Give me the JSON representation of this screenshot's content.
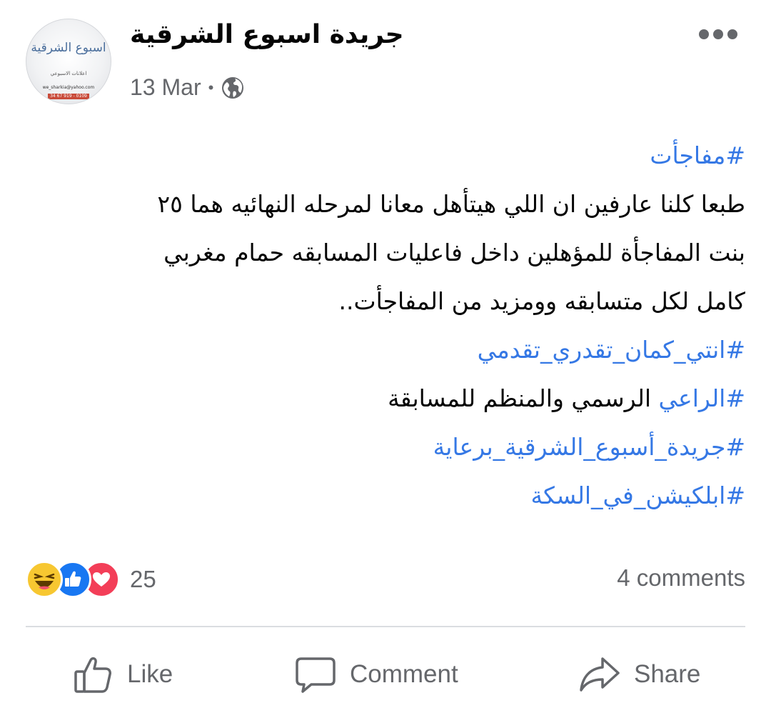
{
  "post": {
    "page_name": "جريدة اسبوع الشرقية",
    "timestamp": "13 Mar",
    "separator": "•",
    "privacy_icon": "globe-icon",
    "avatar": {
      "logo_text": "اسبوع الشرقية",
      "tagline": "اعلانات الاسبوعي",
      "email": "we_sharkia@yahoo.com",
      "phone": "34 67 919 - 0109"
    },
    "body": {
      "hashtag_1": "#مفاجأت",
      "text_line_1": "طبعا كلنا عارفين ان اللي هيتأهل معانا لمرحله النهائيه هما ٢٥",
      "text_line_2": "بنت المفاجأة للمؤهلين داخل فاعليات المسابقه حمام مغربي",
      "text_line_3": "كامل لكل متسابقه وومزيد من المفاجأت..",
      "hashtag_2": "#انتي_كمان_تقدري_تقدمي",
      "hashtag_3": "#الراعي",
      "text_line_4": " الرسمي والمنظم للمسابقة",
      "hashtag_4": "#جريدة_أسبوع_الشرقية_برعاية",
      "hashtag_5": "#ابلكيشن_في_السكة"
    },
    "reactions": {
      "icons": [
        "haha-icon",
        "like-icon",
        "love-icon"
      ],
      "count": "25"
    },
    "comments_count": "4 comments",
    "actions": {
      "like_label": "Like",
      "comment_label": "Comment",
      "share_label": "Share"
    },
    "colors": {
      "hashtag": "#3578e5",
      "secondary_text": "#65676b",
      "like_blue": "#1877f2",
      "love_red": "#f33e58",
      "haha_yellow": "#f7c731"
    }
  }
}
